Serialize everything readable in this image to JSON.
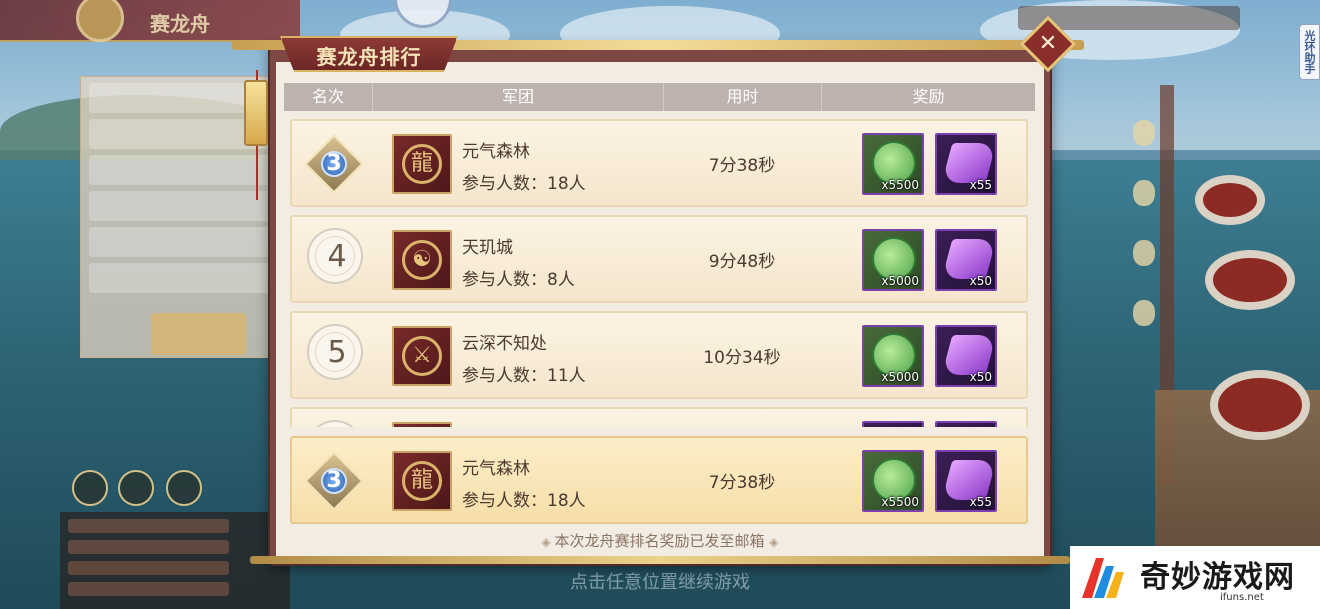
{
  "background": {
    "top_banner_title": "赛龙舟",
    "helper_tab": "光环助手",
    "continue_hint": "点击任意位置继续游戏"
  },
  "dialog": {
    "title": "赛龙舟排行",
    "close_icon": "close-icon",
    "headers": [
      "名次",
      "军团",
      "用时",
      "奖励"
    ],
    "rows": [
      {
        "rank": "3",
        "rank_style": "badge",
        "legion_icon": "dragon-emblem-icon",
        "name": "元气森林",
        "members": "参与人数：18人",
        "time": "7分38秒",
        "rewards": [
          {
            "icon": "jade-dragon-icon",
            "count": "x5500"
          },
          {
            "icon": "purple-silk-icon",
            "count": "x55"
          }
        ]
      },
      {
        "rank": "4",
        "rank_style": "plain",
        "legion_icon": "yin-yang-emblem-icon",
        "name": "天玑城",
        "members": "参与人数：8人",
        "time": "9分48秒",
        "rewards": [
          {
            "icon": "jade-dragon-icon",
            "count": "x5000"
          },
          {
            "icon": "purple-silk-icon",
            "count": "x50"
          }
        ]
      },
      {
        "rank": "5",
        "rank_style": "plain",
        "legion_icon": "sword-emblem-icon",
        "name": "云深不知处",
        "members": "参与人数：11人",
        "time": "10分34秒",
        "rewards": [
          {
            "icon": "jade-dragon-icon",
            "count": "x5000"
          },
          {
            "icon": "purple-silk-icon",
            "count": "x50"
          }
        ]
      }
    ],
    "my_row": {
      "rank": "3",
      "rank_style": "badge",
      "legion_icon": "dragon-emblem-icon",
      "name": "元气森林",
      "members": "参与人数：18人",
      "time": "7分38秒",
      "rewards": [
        {
          "icon": "jade-dragon-icon",
          "count": "x5500"
        },
        {
          "icon": "purple-silk-icon",
          "count": "x55"
        }
      ]
    },
    "footer_note": "本次龙舟赛排名奖励已发至邮箱"
  },
  "watermark": {
    "text": "奇妙游戏网",
    "url": "ifuns.net"
  },
  "colors": {
    "dialog_bg": "#f3ece2",
    "frame": "#7d4843",
    "gold": "#d8b464",
    "header_bg": "#bdb2ad",
    "reward_border": "#7b3fb0"
  }
}
